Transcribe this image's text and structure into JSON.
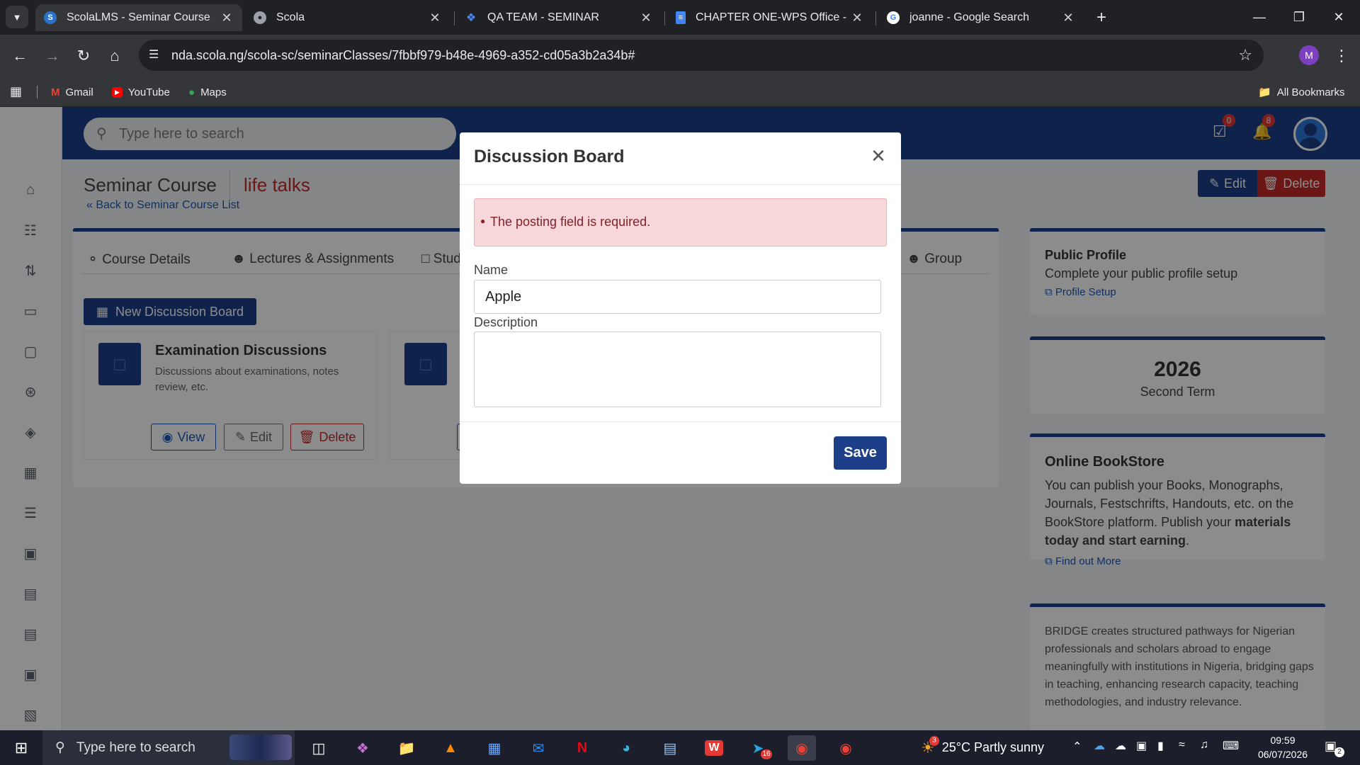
{
  "browser": {
    "tabs": [
      {
        "title": "ScolaLMS - Seminar Course",
        "active": true
      },
      {
        "title": "Scola",
        "active": false
      },
      {
        "title": "QA TEAM - SEMINAR",
        "active": false
      },
      {
        "title": "CHAPTER ONE-WPS Office - Go",
        "active": false
      },
      {
        "title": "joanne - Google Search",
        "active": false
      }
    ],
    "url": "nda.scola.ng/scola-sc/seminarClasses/7fbbf979-b48e-4969-a352-cd05a3b2a34b#",
    "profile_initial": "M",
    "bookmarks": [
      "Gmail",
      "YouTube",
      "Maps"
    ],
    "all_bookmarks": "All Bookmarks"
  },
  "app": {
    "search_placeholder": "Type here to search",
    "tasks_count": "0",
    "notifications_count": "8",
    "page_title": "Seminar Course",
    "course_name": "life talks",
    "back_link": "« Back to Seminar Course List",
    "edit_label": "Edit",
    "delete_label": "Delete",
    "tabs": [
      "Course Details",
      "Lectures & Assignments",
      "Stud",
      "Group"
    ],
    "new_board_label": "New Discussion Board",
    "boards": [
      {
        "title": "Examination Discussions",
        "description": "Discussions about examinations, notes review, etc.",
        "view": "View",
        "edit": "Edit",
        "delete": "Delete"
      }
    ],
    "right": {
      "profile_title": "Public Profile",
      "profile_text": "Complete your public profile setup",
      "profile_link": "Profile Setup",
      "year": "2026",
      "term": "Second Term",
      "bookstore_title": "Online BookStore",
      "bookstore_text": "You can publish your Books, Monographs, Journals, Festschrifts, Handouts, etc. on the BookStore platform. Publish your",
      "bookstore_bold": "materials today and start earning",
      "bookstore_end": ".",
      "bookstore_link": "Find out More",
      "bridge_text": "BRIDGE creates structured pathways for Nigerian professionals and scholars abroad to engage meaningfully with institutions in Nigeria, bridging gaps in teaching, enhancing research capacity, teaching methodologies, and industry relevance."
    }
  },
  "modal": {
    "title": "Discussion Board",
    "error": "The posting field is required.",
    "name_label": "Name",
    "name_value": "Apple",
    "description_label": "Description",
    "description_value": "",
    "save_label": "Save"
  },
  "taskbar": {
    "search_placeholder": "Type here to search",
    "weather": "25°C  Partly sunny",
    "weather_badge": "3",
    "time": "09:59",
    "date": "06/07/2026",
    "notif_count": "2",
    "telegram_badge": "16"
  },
  "colors": {
    "brand": "#1d3f8a",
    "danger": "#c62828",
    "error_bg": "#f8d7da",
    "error_text": "#842029"
  }
}
